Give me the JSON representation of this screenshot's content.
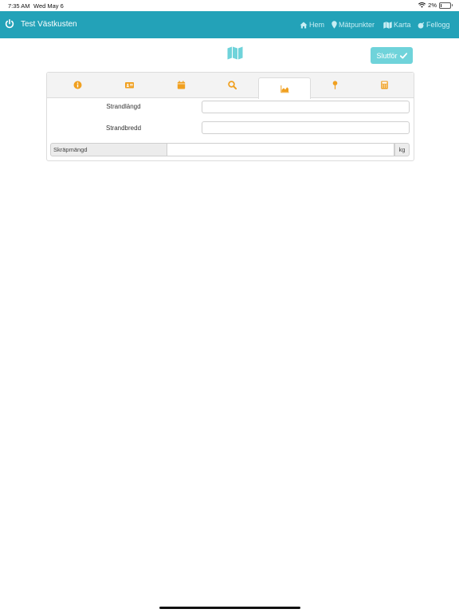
{
  "status_bar": {
    "time": "7:35 AM",
    "date": "Wed May 6",
    "battery_percent": 2,
    "battery_label": "2%"
  },
  "navbar": {
    "title": "Test Västkusten",
    "items": [
      {
        "label": "Hem",
        "icon": "home-icon"
      },
      {
        "label": "Mätpunkter",
        "icon": "map-marker-icon"
      },
      {
        "label": "Karta",
        "icon": "map-icon"
      },
      {
        "label": "Fellogg",
        "icon": "bomb-icon"
      }
    ]
  },
  "toolbar": {
    "finish_label": "Slutför",
    "finish_icon": "check-icon",
    "map_icon": "map-icon"
  },
  "tabs": [
    {
      "icon": "info-circle-icon",
      "active": false
    },
    {
      "icon": "id-card-icon",
      "active": false
    },
    {
      "icon": "calendar-icon",
      "active": false
    },
    {
      "icon": "search-icon",
      "active": false
    },
    {
      "icon": "area-chart-icon",
      "active": true
    },
    {
      "icon": "map-pin-icon",
      "active": false
    },
    {
      "icon": "calculator-icon",
      "active": false
    }
  ],
  "form": {
    "beach_length_label": "Strandlängd",
    "beach_length_value": "",
    "beach_width_label": "Strandbredd",
    "beach_width_value": "",
    "litter_amount_label": "Skräpmängd",
    "litter_amount_value": "",
    "litter_amount_unit": "kg"
  },
  "colors": {
    "primary": "#23a2b8",
    "accent": "#6fd3da",
    "tab_icon": "#f0a020"
  }
}
